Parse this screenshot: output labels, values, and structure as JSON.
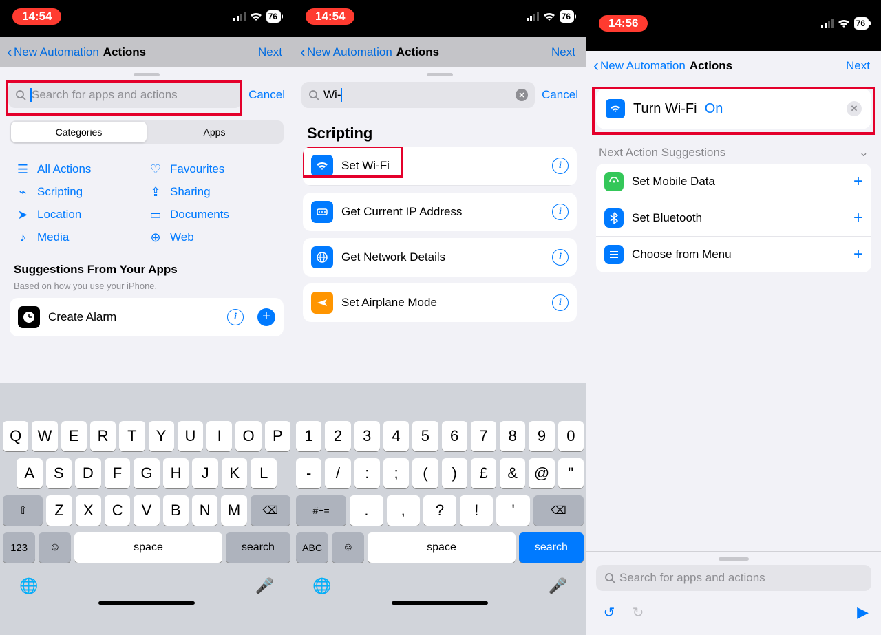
{
  "status": {
    "time1": "14:54",
    "time3": "14:56",
    "battery": "76"
  },
  "nav": {
    "back": "New Automation",
    "title": "Actions",
    "next": "Next"
  },
  "search": {
    "placeholder": "Search for apps and actions",
    "cancel": "Cancel",
    "query": "Wi-"
  },
  "seg": {
    "a": "Categories",
    "b": "Apps"
  },
  "cats": {
    "all": "All Actions",
    "fav": "Favourites",
    "scr": "Scripting",
    "sha": "Sharing",
    "loc": "Location",
    "doc": "Documents",
    "med": "Media",
    "web": "Web"
  },
  "sugSect": {
    "title": "Suggestions From Your Apps",
    "sub": "Based on how you use your iPhone.",
    "first": "Create Alarm"
  },
  "scripting": {
    "header": "Scripting",
    "items": [
      "Set Wi-Fi",
      "Get Current IP Address",
      "Get Network Details",
      "Set Airplane Mode"
    ]
  },
  "col3": {
    "action_prefix": "Turn Wi-Fi",
    "action_value": "On",
    "nsug": "Next Action Suggestions",
    "items": [
      "Set Mobile Data",
      "Set Bluetooth",
      "Choose from Menu"
    ]
  },
  "kb": {
    "r1a": [
      "Q",
      "W",
      "E",
      "R",
      "T",
      "Y",
      "U",
      "I",
      "O",
      "P"
    ],
    "r2a": [
      "A",
      "S",
      "D",
      "F",
      "G",
      "H",
      "J",
      "K",
      "L"
    ],
    "r3a": [
      "Z",
      "X",
      "C",
      "V",
      "B",
      "N",
      "M"
    ],
    "r1b": [
      "1",
      "2",
      "3",
      "4",
      "5",
      "6",
      "7",
      "8",
      "9",
      "0"
    ],
    "r2b": [
      "-",
      "/",
      ":",
      ";",
      "(",
      ")",
      "£",
      "&",
      "@",
      "\""
    ],
    "r3b": [
      ".",
      ",",
      "?",
      "!",
      "'"
    ],
    "shiftLabel": "",
    "numLabel": "123",
    "abcLabel": "ABC",
    "symLabel": "#+=",
    "space": "space",
    "search": "search"
  }
}
